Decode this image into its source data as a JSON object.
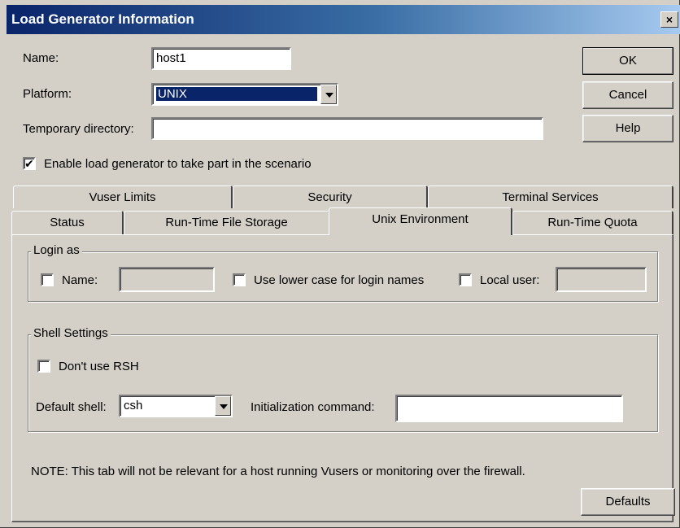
{
  "window": {
    "title": "Load Generator Information",
    "close_glyph": "×"
  },
  "form": {
    "name_label": "Name:",
    "name_value": "host1",
    "platform_label": "Platform:",
    "platform_value": "UNIX",
    "temp_dir_label": "Temporary directory:",
    "temp_dir_value": "",
    "enable_label": "Enable load generator to take part in the scenario",
    "enable_checked": true
  },
  "buttons": {
    "ok": "OK",
    "cancel": "Cancel",
    "help": "Help",
    "defaults": "Defaults"
  },
  "tabs": {
    "row1": [
      "Vuser Limits",
      "Security",
      "Terminal Services"
    ],
    "row2": [
      "Status",
      "Run-Time File Storage",
      "Unix Environment",
      "Run-Time Quota"
    ],
    "active": "Unix Environment"
  },
  "login_as": {
    "title": "Login as",
    "name_label": "Name:",
    "name_value": "",
    "lowercase_label": "Use lower case for login names",
    "local_user_label": "Local user:",
    "local_user_value": ""
  },
  "shell": {
    "title": "Shell Settings",
    "dont_use_rsh_label": "Don't use RSH",
    "default_shell_label": "Default shell:",
    "default_shell_value": "csh",
    "init_cmd_label": "Initialization command:",
    "init_cmd_value": ""
  },
  "note": "NOTE: This tab will not be relevant for a host running Vusers or monitoring over the firewall.",
  "check_glyph": "✔"
}
